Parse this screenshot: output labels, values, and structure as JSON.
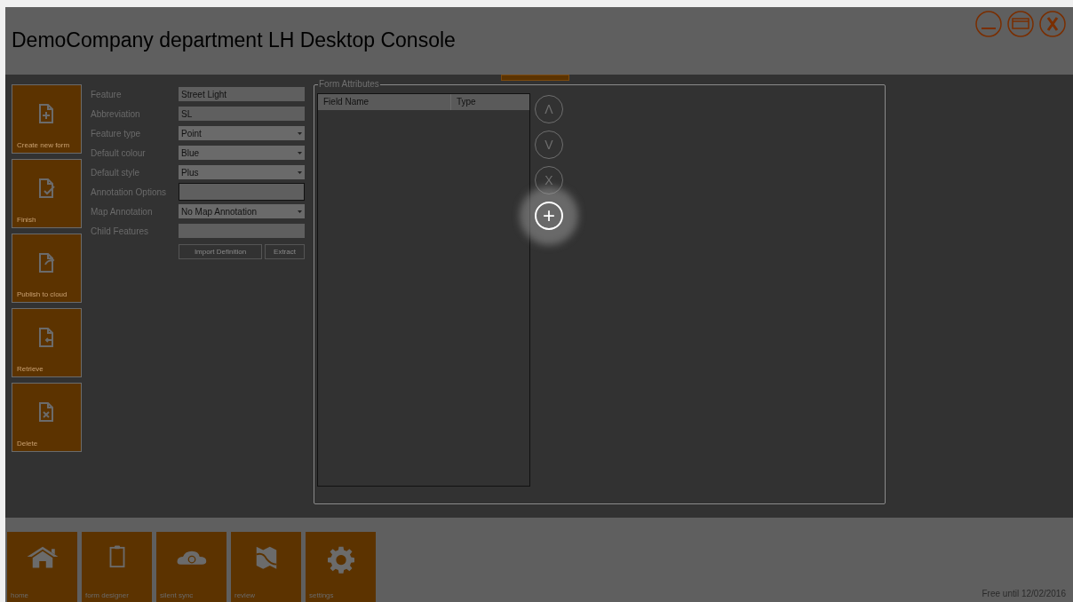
{
  "window": {
    "title": "DemoCompany department LH Desktop Console"
  },
  "side_tiles": [
    {
      "label": "Create new form"
    },
    {
      "label": "Finish"
    },
    {
      "label": "Publish to cloud"
    },
    {
      "label": "Retrieve"
    },
    {
      "label": "Delete"
    }
  ],
  "form": {
    "fields": [
      {
        "label": "Feature",
        "kind": "text",
        "value": "Street Light"
      },
      {
        "label": "Abbreviation",
        "kind": "text",
        "value": "SL"
      },
      {
        "label": "Feature type",
        "kind": "dropdown",
        "value": "Point"
      },
      {
        "label": "Default colour",
        "kind": "dropdown",
        "value": "Blue"
      },
      {
        "label": "Default style",
        "kind": "dropdown",
        "value": "Plus"
      },
      {
        "label": "Annotation Options",
        "kind": "focused"
      },
      {
        "label": "Map Annotation",
        "kind": "dropdown",
        "value": "No Map Annotation"
      },
      {
        "label": "Child Features",
        "kind": "text"
      }
    ],
    "buttons": [
      "Import Definition",
      "Extract"
    ]
  },
  "form_attributes": {
    "title": "Form Attributes",
    "columns": [
      "Field Name",
      "Type"
    ],
    "actions": [
      {
        "label": "Λ",
        "highlighted": false
      },
      {
        "label": "V",
        "highlighted": false
      },
      {
        "label": "X",
        "highlighted": false
      },
      {
        "label": "+",
        "highlighted": true
      }
    ]
  },
  "nav": [
    {
      "label": "home"
    },
    {
      "label": "form designer"
    },
    {
      "label": "silent sync"
    },
    {
      "label": "review"
    },
    {
      "label": "settings"
    }
  ],
  "status": "Free until 12/02/2016"
}
